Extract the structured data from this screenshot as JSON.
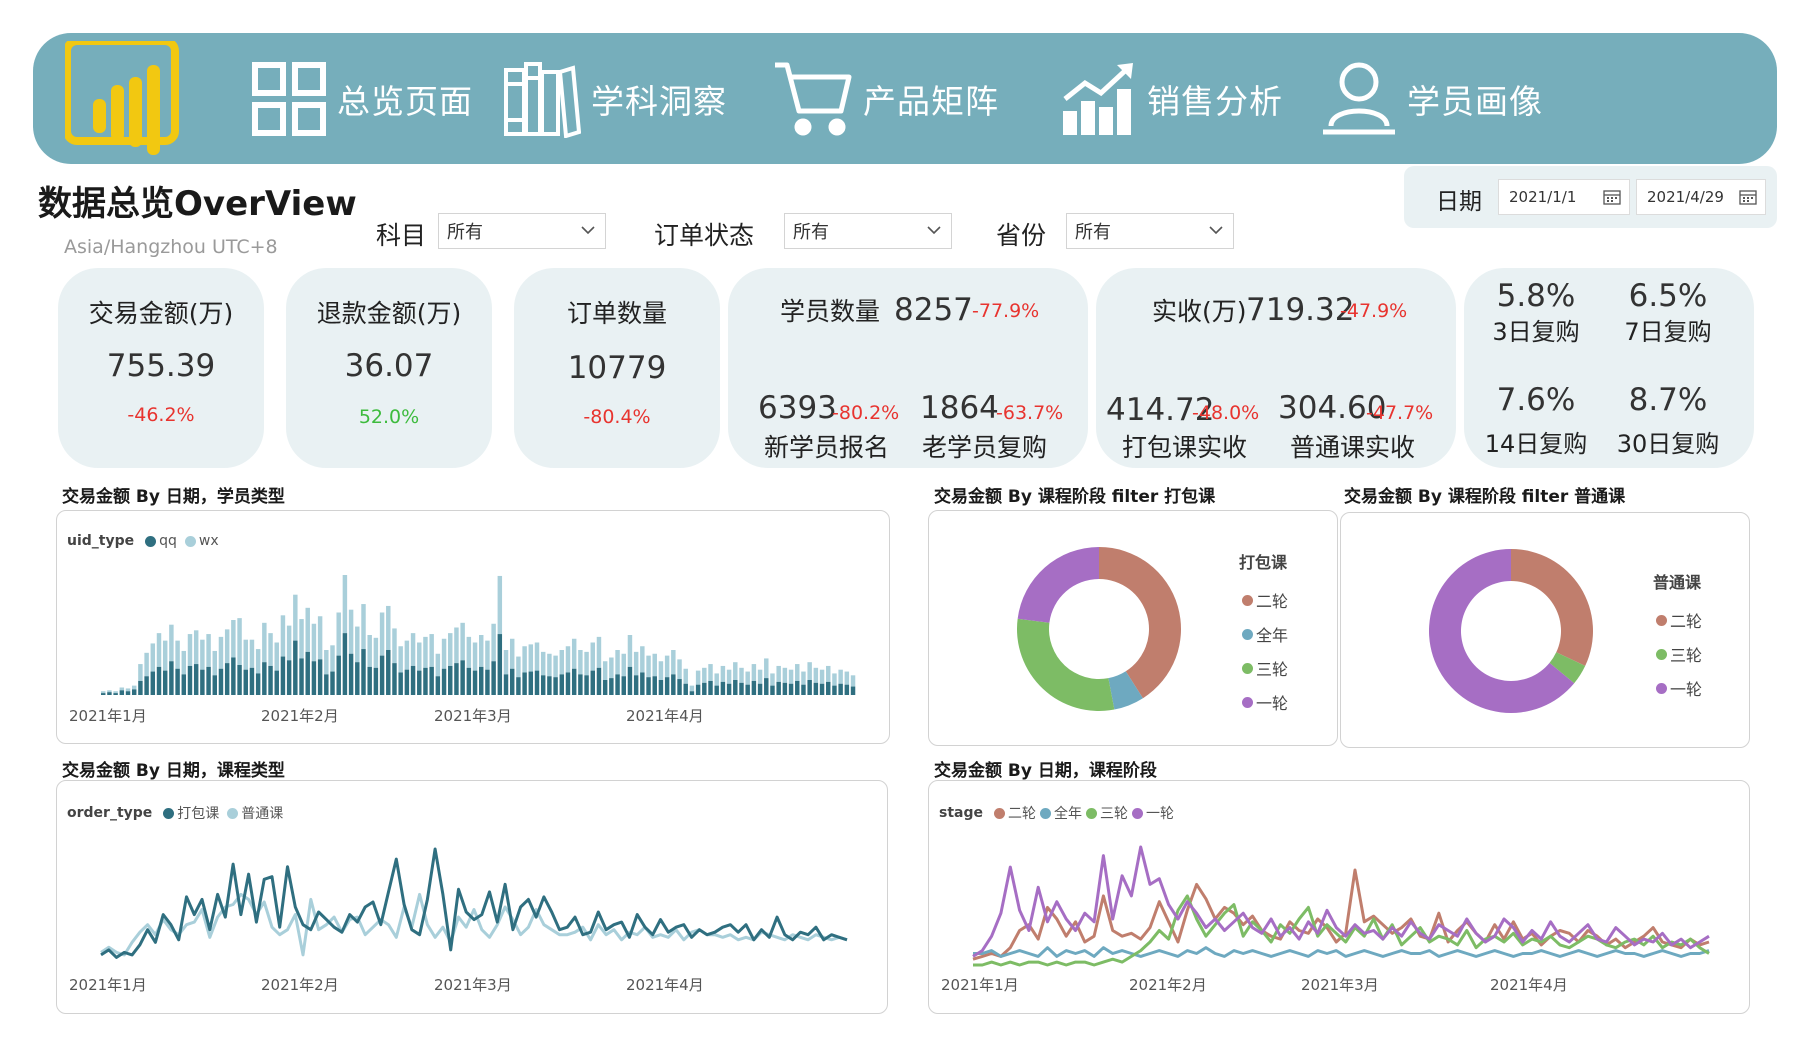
{
  "nav": {
    "items": [
      {
        "label": "总览页面",
        "icon": "dashboard-grid-icon"
      },
      {
        "label": "学科洞察",
        "icon": "books-icon"
      },
      {
        "label": "产品矩阵",
        "icon": "shopping-cart-icon"
      },
      {
        "label": "销售分析",
        "icon": "growth-chart-icon"
      },
      {
        "label": "学员画像",
        "icon": "user-icon"
      }
    ]
  },
  "header": {
    "title": "数据总览OverView",
    "timezone": "Asia/Hangzhou UTC+8"
  },
  "filters": {
    "subject": {
      "label": "科目",
      "value": "所有"
    },
    "order_status": {
      "label": "订单状态",
      "value": "所有"
    },
    "province": {
      "label": "省份",
      "value": "所有"
    },
    "date": {
      "label": "日期",
      "start": "2021/1/1",
      "end": "2021/4/29"
    }
  },
  "kpis": {
    "trade": {
      "label": "交易金额(万)",
      "value": "755.39",
      "delta": "-46.2%"
    },
    "refund": {
      "label": "退款金额(万)",
      "value": "36.07",
      "delta": "52.0%"
    },
    "orders": {
      "label": "订单数量",
      "value": "10779",
      "delta": "-80.4%"
    },
    "students": {
      "label": "学员数量",
      "value": "8257",
      "delta": "-77.9%",
      "new_value": "6393",
      "new_delta": "-80.2%",
      "new_label": "新学员报名",
      "old_value": "1864",
      "old_delta": "-63.7%",
      "old_label": "老学员复购"
    },
    "received": {
      "label": "实收(万)",
      "value": "719.32",
      "delta": "-47.9%",
      "pack_value": "414.72",
      "pack_delta": "-48.0%",
      "pack_label": "打包课实收",
      "normal_value": "304.60",
      "normal_delta": "-47.7%",
      "normal_label": "普通课实收"
    },
    "repurchase": {
      "d3": {
        "value": "5.8%",
        "label": "3日复购"
      },
      "d7": {
        "value": "6.5%",
        "label": "7日复购"
      },
      "d14": {
        "value": "7.6%",
        "label": "14日复购"
      },
      "d30": {
        "value": "8.7%",
        "label": "30日复购"
      }
    }
  },
  "colors": {
    "accent": "#76aebb",
    "qq": "#2f6f80",
    "wx": "#a9cfda",
    "pack": "#2f6f80",
    "normal": "#a9cfda",
    "stage_2": "#c07e6d",
    "stage_full": "#6ea9c0",
    "stage_3": "#7dbc65",
    "stage_1": "#a66ec4",
    "negative": "#e8342f",
    "positive": "#3dbb3d"
  },
  "chart_data": [
    {
      "type": "bar",
      "title": "交易金额 By 日期，学员类型",
      "legend_title": "uid_type",
      "stacked": true,
      "x_tick_labels": [
        "2021年1月",
        "2021年2月",
        "2021年3月",
        "2021年4月"
      ],
      "series": [
        {
          "name": "qq",
          "values": [
            0.2,
            0.3,
            0.2,
            0.5,
            0.4,
            0.6,
            1.5,
            2.0,
            2.5,
            3.0,
            2.6,
            3.6,
            2.8,
            2.2,
            3.1,
            3.3,
            2.7,
            3.0,
            2.1,
            2.8,
            3.4,
            4.0,
            3.2,
            2.7,
            2.9,
            2.3,
            3.5,
            3.1,
            2.6,
            4.1,
            3.7,
            5.8,
            3.9,
            4.6,
            3.6,
            3.8,
            2.2,
            2.5,
            4.2,
            6.6,
            4.4,
            3.5,
            4.9,
            3.0,
            2.9,
            4.2,
            4.8,
            3.4,
            2.4,
            2.7,
            3.1,
            2.6,
            2.9,
            3.0,
            2.0,
            2.8,
            3.1,
            3.4,
            3.7,
            2.9,
            2.6,
            3.0,
            2.7,
            3.6,
            6.5,
            2.2,
            2.8,
            1.9,
            2.4,
            2.5,
            2.6,
            2.1,
            2.0,
            1.9,
            2.2,
            2.4,
            2.8,
            2.2,
            2.1,
            2.6,
            2.9,
            1.6,
            1.8,
            2.2,
            2.0,
            3.0,
            2.1,
            2.4,
            1.9,
            2.0,
            1.6,
            1.9,
            2.2,
            1.7,
            1.2,
            0.4,
            1.1,
            1.3,
            1.5,
            1.0,
            1.4,
            1.2,
            1.6,
            1.3,
            1.1,
            1.5,
            1.2,
            1.8,
            1.0,
            1.4,
            1.3,
            1.2,
            1.5,
            1.1,
            1.6,
            1.3,
            1.2,
            1.4,
            1.0,
            1.2,
            1.1,
            0.9
          ]
        },
        {
          "name": "wx",
          "values": [
            0.2,
            0.2,
            0.2,
            0.3,
            0.3,
            0.4,
            1.8,
            2.5,
            3.0,
            3.6,
            3.2,
            3.9,
            3.0,
            2.5,
            3.4,
            3.6,
            3.2,
            3.5,
            2.6,
            3.4,
            3.6,
            4.0,
            5.0,
            3.2,
            3.0,
            2.6,
            4.2,
            3.5,
            3.0,
            4.4,
            3.7,
            4.9,
            4.2,
            4.7,
            4.0,
            4.6,
            2.6,
            2.8,
            4.6,
            6.2,
            4.7,
            3.8,
            4.8,
            3.4,
            3.2,
            4.6,
            4.7,
            3.7,
            2.8,
            3.1,
            3.5,
            3.0,
            3.3,
            3.5,
            2.4,
            3.2,
            3.5,
            3.8,
            4.0,
            3.3,
            3.0,
            3.4,
            3.1,
            4.0,
            6.2,
            2.6,
            3.2,
            2.2,
            2.8,
            2.9,
            3.0,
            2.5,
            2.4,
            2.3,
            2.6,
            2.8,
            3.2,
            2.6,
            2.5,
            3.0,
            3.3,
            2.0,
            2.2,
            2.6,
            2.4,
            3.4,
            2.5,
            2.8,
            2.3,
            2.4,
            2.0,
            2.3,
            2.6,
            2.1,
            1.6,
            0.6,
            1.5,
            1.6,
            1.8,
            1.3,
            1.7,
            1.5,
            1.9,
            1.6,
            1.4,
            1.8,
            1.5,
            2.1,
            1.3,
            1.7,
            1.6,
            1.5,
            1.8,
            1.4,
            1.9,
            1.6,
            1.5,
            1.7,
            1.3,
            1.5,
            1.4,
            1.2
          ]
        }
      ]
    },
    {
      "type": "pie",
      "title": "交易金额 By 课程阶段 filter 打包课",
      "legend_title": "打包课",
      "variant": "donut",
      "slices": [
        {
          "name": "二轮",
          "value": 41
        },
        {
          "name": "全年",
          "value": 6
        },
        {
          "name": "三轮",
          "value": 30
        },
        {
          "name": "一轮",
          "value": 23
        }
      ]
    },
    {
      "type": "pie",
      "title": "交易金额 By 课程阶段 filter 普通课",
      "legend_title": "普通课",
      "variant": "donut",
      "slices": [
        {
          "name": "二轮",
          "value": 32
        },
        {
          "name": "三轮",
          "value": 4
        },
        {
          "name": "一轮",
          "value": 64
        }
      ]
    },
    {
      "type": "line",
      "title": "交易金额 By 日期，课程类型",
      "legend_title": "order_type",
      "x_tick_labels": [
        "2021年1月",
        "2021年2月",
        "2021年3月",
        "2021年4月"
      ],
      "series": [
        {
          "name": "打包课",
          "values": [
            0.4,
            0.6,
            0.3,
            0.5,
            0.4,
            0.8,
            1.4,
            0.9,
            2.0,
            1.6,
            1.0,
            2.7,
            2.0,
            2.6,
            1.4,
            2.8,
            1.9,
            4.0,
            2.0,
            3.6,
            1.7,
            3.4,
            3.5,
            1.5,
            3.9,
            2.3,
            1.6,
            1.4,
            2.1,
            1.8,
            1.5,
            1.3,
            2.0,
            1.7,
            2.3,
            2.5,
            1.6,
            2.9,
            4.2,
            2.4,
            1.4,
            1.2,
            2.6,
            4.6,
            2.8,
            0.6,
            3.0,
            2.1,
            1.8,
            2.0,
            2.9,
            1.7,
            3.2,
            1.4,
            2.3,
            2.6,
            1.9,
            2.7,
            2.1,
            1.4,
            1.5,
            1.9,
            1.2,
            1.3,
            2.1,
            1.4,
            1.6,
            1.7,
            1.1,
            2.0,
            1.5,
            1.2,
            1.8,
            1.3,
            1.5,
            1.6,
            1.1,
            1.4,
            1.2,
            1.3,
            1.5,
            1.6,
            1.3,
            1.6,
            1.0,
            1.4,
            1.1,
            1.9,
            1.2,
            1.0,
            1.3,
            1.2,
            1.5,
            1.0,
            1.2,
            1.1,
            1.0
          ]
        },
        {
          "name": "普通课",
          "values": [
            0.5,
            0.7,
            0.5,
            0.4,
            0.9,
            1.3,
            1.6,
            1.2,
            1.8,
            1.4,
            1.2,
            1.6,
            1.7,
            2.2,
            1.1,
            1.9,
            2.3,
            2.4,
            2.8,
            2.6,
            2.0,
            2.5,
            1.5,
            1.2,
            1.4,
            2.0,
            0.4,
            2.6,
            1.4,
            1.6,
            1.9,
            1.3,
            1.8,
            1.9,
            1.2,
            1.5,
            1.8,
            1.6,
            1.1,
            2.3,
            1.5,
            2.8,
            1.6,
            1.1,
            1.5,
            0.9,
            1.9,
            1.5,
            2.2,
            1.4,
            1.1,
            1.6,
            2.3,
            1.8,
            1.2,
            1.5,
            2.2,
            1.6,
            1.4,
            1.2,
            1.2,
            1.3,
            1.5,
            1.0,
            1.6,
            1.2,
            1.4,
            1.0,
            1.3,
            1.2,
            1.5,
            1.1,
            1.2,
            1.1,
            1.4,
            1.0,
            1.3,
            1.4,
            1.2,
            1.2,
            1.1,
            1.2,
            1.0,
            1.1,
            1.0,
            1.3,
            1.2,
            1.1,
            1.0,
            1.2,
            1.1,
            1.0,
            1.2,
            1.1,
            1.0,
            1.1,
            1.0
          ]
        }
      ]
    },
    {
      "type": "line",
      "title": "交易金额 By 日期，课程阶段",
      "legend_title": "stage",
      "x_tick_labels": [
        "2021年1月",
        "2021年2月",
        "2021年3月",
        "2021年4月"
      ],
      "series": [
        {
          "name": "二轮",
          "values": [
            0.2,
            0.3,
            0.4,
            0.3,
            0.6,
            1.2,
            1.4,
            0.9,
            2.0,
            1.6,
            1.0,
            1.5,
            0.8,
            1.0,
            2.4,
            1.2,
            1.0,
            1.1,
            0.9,
            1.3,
            2.2,
            1.5,
            0.8,
            1.9,
            2.8,
            2.3,
            1.6,
            2.0,
            1.8,
            1.4,
            1.7,
            1.2,
            1.0,
            0.9,
            1.5,
            1.2,
            1.1,
            1.6,
            1.3,
            0.8,
            1.1,
            3.3,
            1.5,
            1.7,
            1.4,
            1.1,
            1.3,
            1.6,
            1.0,
            0.9,
            1.8,
            0.8,
            1.2,
            1.5,
            1.1,
            0.8,
            1.4,
            0.9,
            1.5,
            0.9,
            1.1,
            0.7,
            1.0,
            1.2,
            1.1,
            0.8,
            1.2,
            1.0,
            0.7,
            0.9,
            0.6,
            0.8,
            1.0,
            1.3,
            0.8,
            0.7,
            0.6,
            0.9,
            0.7,
            0.8
          ]
        },
        {
          "name": "全年",
          "values": [
            0.4,
            0.4,
            0.5,
            0.3,
            0.4,
            0.5,
            0.4,
            0.3,
            0.6,
            0.3,
            0.5,
            0.4,
            0.5,
            0.3,
            0.6,
            0.4,
            0.5,
            0.4,
            0.3,
            0.4,
            0.5,
            0.4,
            0.3,
            0.5,
            0.4,
            0.6,
            0.4,
            0.3,
            0.5,
            0.4,
            0.5,
            0.4,
            0.3,
            0.4,
            0.5,
            0.4,
            0.3,
            0.5,
            0.4,
            0.5,
            0.3,
            0.4,
            0.5,
            0.4,
            0.3,
            0.4,
            0.5,
            0.4,
            0.4,
            0.5,
            0.3,
            0.4,
            0.5,
            0.4,
            0.3,
            0.4,
            0.5,
            0.4,
            0.3,
            0.4,
            0.4,
            0.5,
            0.4,
            0.3,
            0.4,
            0.5,
            0.4,
            0.3,
            0.4,
            0.5,
            0.4,
            0.4,
            0.3,
            0.4,
            0.5,
            0.4,
            0.3,
            0.4,
            0.4,
            0.5
          ]
        },
        {
          "name": "三轮",
          "values": [
            0.0,
            0.0,
            0.1,
            0.0,
            0.1,
            0.0,
            0.1,
            0.1,
            0.0,
            0.1,
            0.0,
            0.1,
            0.1,
            0.0,
            0.1,
            0.2,
            0.1,
            0.3,
            0.5,
            0.8,
            1.2,
            0.9,
            1.9,
            2.4,
            1.6,
            1.0,
            1.4,
            1.8,
            2.1,
            1.0,
            1.5,
            1.2,
            0.8,
            1.4,
            1.1,
            1.6,
            2.0,
            1.0,
            1.4,
            1.1,
            0.8,
            1.3,
            1.0,
            1.6,
            0.9,
            1.4,
            0.7,
            1.0,
            1.3,
            0.8,
            1.0,
            0.9,
            0.7,
            1.2,
            0.6,
            0.9,
            1.0,
            0.8,
            1.1,
            0.7,
            0.9,
            0.8,
            1.0,
            0.7,
            0.6,
            0.8,
            1.0,
            0.9,
            0.7,
            0.6,
            0.8,
            0.9,
            0.7,
            1.0,
            0.6,
            0.8,
            0.7,
            0.9,
            0.6,
            0.4
          ]
        },
        {
          "name": "一轮",
          "values": [
            0.3,
            0.5,
            1.0,
            1.8,
            3.4,
            1.9,
            1.2,
            2.7,
            1.5,
            2.2,
            1.6,
            1.2,
            1.8,
            1.5,
            3.8,
            1.6,
            3.1,
            2.4,
            4.1,
            2.8,
            3.0,
            2.1,
            1.6,
            2.2,
            1.8,
            1.3,
            1.6,
            1.2,
            1.5,
            1.8,
            1.3,
            1.1,
            1.6,
            1.0,
            1.3,
            0.9,
            1.5,
            1.1,
            1.9,
            1.3,
            1.0,
            1.4,
            1.1,
            1.2,
            0.9,
            1.3,
            1.0,
            1.5,
            1.1,
            0.9,
            1.4,
            1.2,
            1.0,
            1.6,
            1.1,
            0.8,
            1.0,
            1.6,
            1.3,
            0.8,
            1.2,
            0.9,
            1.5,
            1.0,
            0.8,
            1.1,
            1.4,
            0.9,
            0.8,
            1.3,
            1.0,
            0.7,
            0.9,
            0.8,
            1.1,
            0.7,
            0.9,
            0.6,
            0.8,
            1.0
          ]
        }
      ]
    }
  ]
}
